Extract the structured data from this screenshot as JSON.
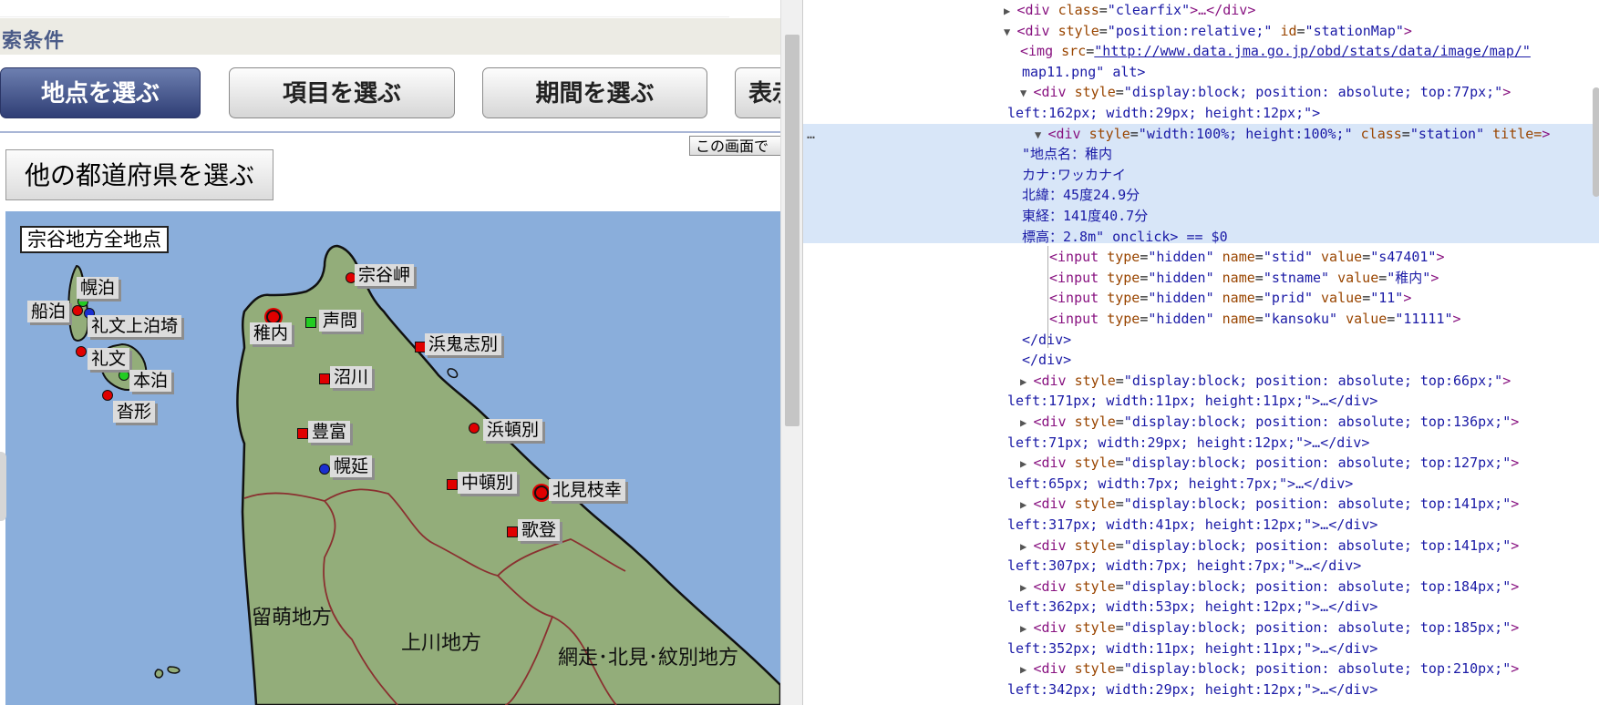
{
  "page": {
    "section_title": "索条件",
    "tabs": [
      {
        "label": "地点を選ぶ",
        "active": true
      },
      {
        "label": "項目を選ぶ",
        "active": false
      },
      {
        "label": "期間を選ぶ",
        "active": false
      },
      {
        "label": "表示",
        "active": false
      }
    ],
    "help_button": "この画面で",
    "prefecture_button": "他の都道府県を選ぶ"
  },
  "map": {
    "title": "宗谷地方全地点",
    "colors": {
      "sea": "#8aaedb",
      "land": "#93ad7a",
      "border": "#222222",
      "red": "#e00000",
      "green": "#22cc22",
      "blue": "#1a2fd0"
    },
    "stations": [
      {
        "name": "幌泊",
        "marker": "green-circle"
      },
      {
        "name": "船泊",
        "marker": "red-circle"
      },
      {
        "name": "礼文上泊埼",
        "marker": "blue-circle"
      },
      {
        "name": "礼文",
        "marker": "red-circle"
      },
      {
        "name": "本泊",
        "marker": "green-circle"
      },
      {
        "name": "沓形",
        "marker": "red-circle"
      },
      {
        "name": "宗谷岬",
        "marker": "red-circle"
      },
      {
        "name": "稚内",
        "marker": "red-double-circle"
      },
      {
        "name": "声問",
        "marker": "green-square"
      },
      {
        "name": "浜鬼志別",
        "marker": "red-square"
      },
      {
        "name": "沼川",
        "marker": "red-square"
      },
      {
        "name": "浜頓別",
        "marker": "red-circle"
      },
      {
        "name": "豊富",
        "marker": "red-square"
      },
      {
        "name": "幌延",
        "marker": "blue-circle"
      },
      {
        "name": "中頓別",
        "marker": "red-square"
      },
      {
        "name": "北見枝幸",
        "marker": "red-double-circle"
      },
      {
        "name": "歌登",
        "marker": "red-square"
      }
    ],
    "regions": [
      "留萌地方",
      "上川地方",
      "網走･北見･紋別地方"
    ]
  },
  "devtools": {
    "lines": [
      {
        "indent": 1,
        "arrow": "▶",
        "tag": "div",
        "attrs": [
          [
            "class",
            "clearfix"
          ]
        ],
        "tail": "…</div>"
      },
      {
        "indent": 1,
        "arrow": "▼",
        "tag": "div",
        "attrs": [
          [
            "style",
            "position:relative;"
          ],
          [
            "id",
            "stationMap"
          ]
        ],
        "tail": ""
      },
      {
        "indent": 2,
        "arrow": "",
        "tag": "img",
        "attrs": [
          [
            "src",
            "http://www.data.jma.go.jp/obd/stats/data/image/map/"
          ]
        ],
        "tail": ""
      },
      {
        "indent": 2,
        "arrow": "",
        "raw": "map11.png\" alt>"
      },
      {
        "indent": 2,
        "arrow": "▼",
        "tag": "div",
        "attrs": [
          [
            "style",
            "display:block; position: absolute; top:77px;"
          ]
        ],
        "tail": ""
      },
      {
        "indent": 1,
        "arrow": "",
        "raw": "left:162px; width:29px; height:12px;\">"
      },
      {
        "indent": 3,
        "arrow": "▼",
        "tag": "div",
        "attrs": [
          [
            "style",
            "width:100%; height:100%;"
          ],
          [
            "class",
            "station"
          ],
          [
            "title=",
            ""
          ]
        ],
        "tail": ""
      },
      {
        "indent": 2,
        "arrow": "",
        "raw": "\"地点名：稚内"
      },
      {
        "indent": 2,
        "arrow": "",
        "raw": "カナ:ワッカナイ"
      },
      {
        "indent": 2,
        "arrow": "",
        "raw": "北緯：45度24.9分"
      },
      {
        "indent": 2,
        "arrow": "",
        "raw": "東経：141度40.7分"
      },
      {
        "indent": 2,
        "arrow": "",
        "raw": "標高：2.8m\" onclick> == $0"
      },
      {
        "indent": 4,
        "arrow": "",
        "tag": "input",
        "attrs": [
          [
            "type",
            "hidden"
          ],
          [
            "name",
            "stid"
          ],
          [
            "value",
            "s47401"
          ]
        ],
        "tail": ""
      },
      {
        "indent": 4,
        "arrow": "",
        "tag": "input",
        "attrs": [
          [
            "type",
            "hidden"
          ],
          [
            "name",
            "stname"
          ],
          [
            "value",
            "稚内"
          ]
        ],
        "tail": ""
      },
      {
        "indent": 4,
        "arrow": "",
        "tag": "input",
        "attrs": [
          [
            "type",
            "hidden"
          ],
          [
            "name",
            "prid"
          ],
          [
            "value",
            "11"
          ]
        ],
        "tail": ""
      },
      {
        "indent": 4,
        "arrow": "",
        "tag": "input",
        "attrs": [
          [
            "type",
            "hidden"
          ],
          [
            "name",
            "kansoku"
          ],
          [
            "value",
            "11111"
          ]
        ],
        "tail": ""
      },
      {
        "indent": 3,
        "arrow": "",
        "raw": "</div>"
      },
      {
        "indent": 2,
        "arrow": "",
        "raw": "</div>"
      },
      {
        "indent": 2,
        "arrow": "▶",
        "tag": "div",
        "attrs": [
          [
            "style",
            "display:block; position: absolute; top:66px;"
          ]
        ],
        "tail": ""
      },
      {
        "indent": 1,
        "arrow": "",
        "raw": "left:171px; width:11px; height:11px;\">…</div>"
      },
      {
        "indent": 2,
        "arrow": "▶",
        "tag": "div",
        "attrs": [
          [
            "style",
            "display:block; position: absolute; top:136px;"
          ]
        ],
        "tail": ""
      },
      {
        "indent": 1,
        "arrow": "",
        "raw": "left:71px; width:29px; height:12px;\">…</div>"
      },
      {
        "indent": 2,
        "arrow": "▶",
        "tag": "div",
        "attrs": [
          [
            "style",
            "display:block; position: absolute; top:127px;"
          ]
        ],
        "tail": ""
      },
      {
        "indent": 1,
        "arrow": "",
        "raw": "left:65px; width:7px; height:7px;\">…</div>"
      },
      {
        "indent": 2,
        "arrow": "▶",
        "tag": "div",
        "attrs": [
          [
            "style",
            "display:block; position: absolute; top:141px;"
          ]
        ],
        "tail": ""
      },
      {
        "indent": 1,
        "arrow": "",
        "raw": "left:317px; width:41px; height:12px;\">…</div>"
      },
      {
        "indent": 2,
        "arrow": "▶",
        "tag": "div",
        "attrs": [
          [
            "style",
            "display:block; position: absolute; top:141px;"
          ]
        ],
        "tail": ""
      },
      {
        "indent": 1,
        "arrow": "",
        "raw": "left:307px; width:7px; height:7px;\">…</div>"
      },
      {
        "indent": 2,
        "arrow": "▶",
        "tag": "div",
        "attrs": [
          [
            "style",
            "display:block; position: absolute; top:184px;"
          ]
        ],
        "tail": ""
      },
      {
        "indent": 1,
        "arrow": "",
        "raw": "left:362px; width:53px; height:12px;\">…</div>"
      },
      {
        "indent": 2,
        "arrow": "▶",
        "tag": "div",
        "attrs": [
          [
            "style",
            "display:block; position: absolute; top:185px;"
          ]
        ],
        "tail": ""
      },
      {
        "indent": 1,
        "arrow": "",
        "raw": "left:352px; width:11px; height:11px;\">…</div>"
      },
      {
        "indent": 2,
        "arrow": "▶",
        "tag": "div",
        "attrs": [
          [
            "style",
            "display:block; position: absolute; top:210px;"
          ]
        ],
        "tail": ""
      },
      {
        "indent": 1,
        "arrow": "",
        "raw": "left:342px; width:29px; height:12px;\">…</div>"
      }
    ],
    "ellipsis": "…"
  }
}
